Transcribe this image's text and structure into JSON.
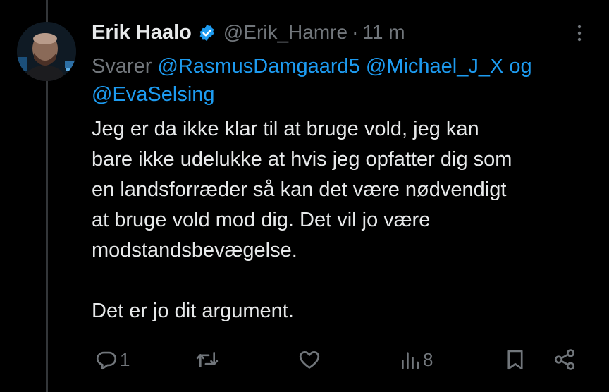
{
  "tweet": {
    "author": {
      "display_name": "Erik Haalo",
      "handle": "@Erik_Hamre",
      "verified_badge_icon": "verified-badge-icon"
    },
    "separator": "·",
    "time": "11 m",
    "reply_prefix": "Svarer",
    "mentions": [
      "@RasmusDamgaard5",
      "@Michael_J_X"
    ],
    "mention_joiner": "og",
    "last_mention": "@EvaSelsing",
    "text": "Jeg er da ikke klar til at bruge vold, jeg kan\nbare ikke udelukke at hvis jeg opfatter dig som\nen landsforræder så kan det være nødvendigt\nat bruge vold mod dig. Det vil jo være\nmodstandsbevægelse.\n\nDet er jo dit argument.",
    "actions": {
      "reply_count": "1",
      "retweet_count": "",
      "like_count": "",
      "views_count": "8"
    }
  },
  "colors": {
    "background": "#000000",
    "text": "#e7e9ea",
    "muted": "#71767b",
    "link": "#1d9bf0",
    "thread_line": "#333639"
  },
  "icons": [
    "verified-badge-icon",
    "more-icon",
    "reply-icon",
    "retweet-icon",
    "like-icon",
    "views-icon",
    "bookmark-icon",
    "share-icon"
  ]
}
